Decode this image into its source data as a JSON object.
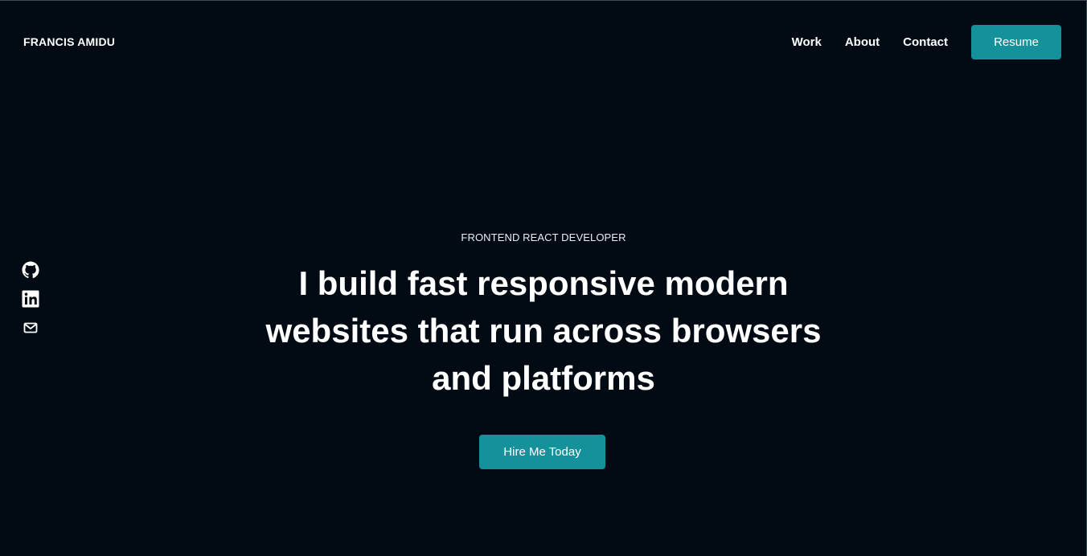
{
  "header": {
    "brand": "FRANCIS AMIDU",
    "nav": [
      {
        "label": "Work"
      },
      {
        "label": "About"
      },
      {
        "label": "Contact"
      }
    ],
    "resume_label": "Resume"
  },
  "socials": [
    {
      "icon": "github-icon"
    },
    {
      "icon": "linkedin-icon"
    },
    {
      "icon": "mail-icon"
    }
  ],
  "hero": {
    "kicker": "FRONTEND REACT DEVELOPER",
    "headline": "I build fast responsive modern websites that run across browsers and platforms",
    "cta_label": "Hire Me Today"
  },
  "colors": {
    "background": "#020b14",
    "accent": "#14919b",
    "text": "#ffffff"
  }
}
